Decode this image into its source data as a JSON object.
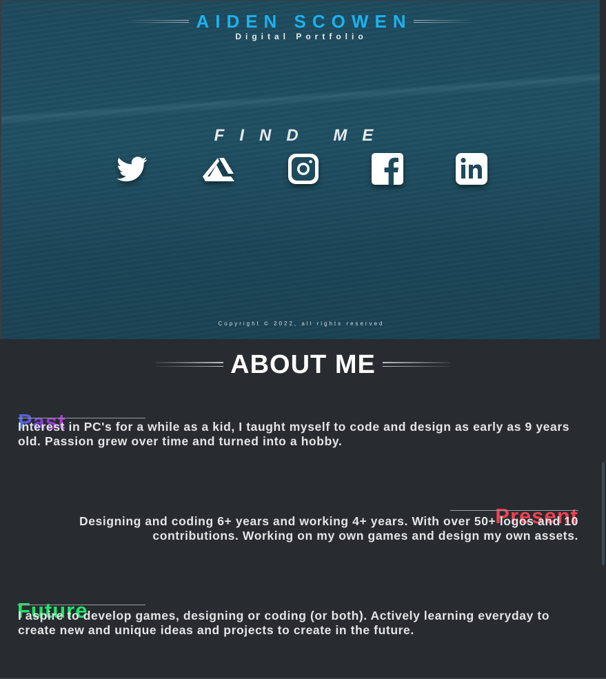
{
  "header": {
    "name": "AIDEN SCOWEN",
    "subtitle": "Digital Portfolio"
  },
  "social": {
    "heading": "FIND ME",
    "links": [
      {
        "name": "twitter",
        "icon": "twitter-icon"
      },
      {
        "name": "artstation",
        "icon": "artstation-icon"
      },
      {
        "name": "instagram",
        "icon": "instagram-icon"
      },
      {
        "name": "facebook",
        "icon": "facebook-icon"
      },
      {
        "name": "linkedin",
        "icon": "linkedin-icon"
      }
    ]
  },
  "copyright": "Copyright © 2022, all rights reserved",
  "about": {
    "title": "ABOUT ME",
    "sections": [
      {
        "heading": "Past",
        "text": "Interest in PC's for a while as a kid, I taught myself to code and design as early as 9 years old. Passion grew over time and turned into a hobby."
      },
      {
        "heading": "Present",
        "text": "Designing and coding 6+ years and working 4+ years. With over 50+ logos and 10 contributions. Working on my own games and design my own assets."
      },
      {
        "heading": "Future",
        "text": "I aspire to develop games, designing or coding (or both). Actively learning everyday to create new and unique ideas and projects to create in the future."
      }
    ]
  },
  "colors": {
    "brand": "#1ab2f0",
    "past": "#8a3ad0",
    "present": "#f0404e",
    "future": "#19e86a",
    "background": "#282b30"
  }
}
